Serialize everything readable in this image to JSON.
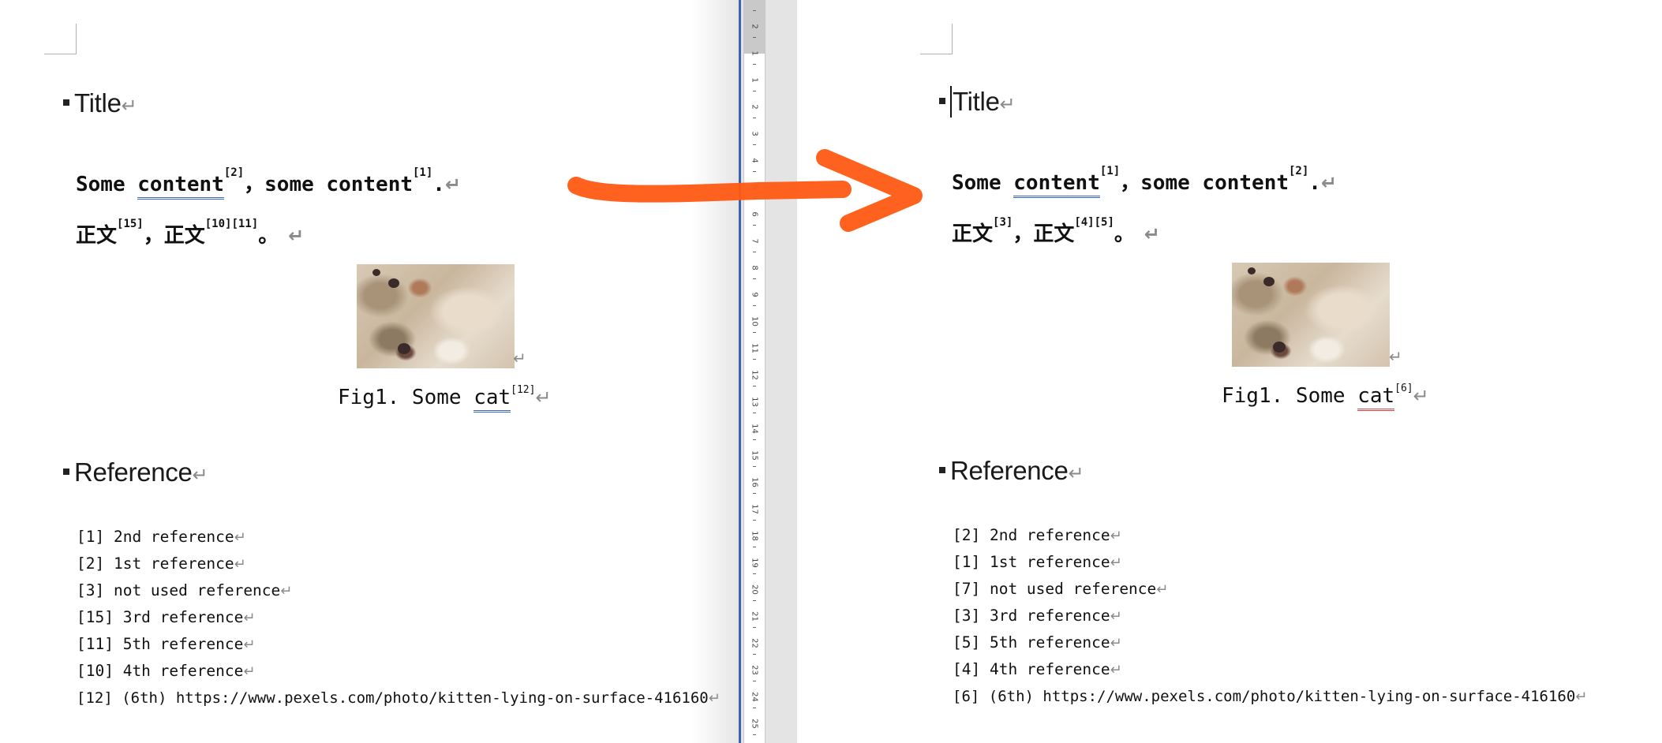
{
  "left": {
    "title": "Title",
    "line1": {
      "a": "Some ",
      "b": "content",
      "c": "[2]",
      "d": "，some content",
      "e": "[1]",
      "f": "."
    },
    "line2": {
      "a": "正文",
      "b": "[15]",
      "c": "，正文",
      "d": "[10][11]",
      "e": "。"
    },
    "caption": {
      "a": "Fig1. Some ",
      "b": "cat",
      "c": "[12]"
    },
    "reference_heading": "Reference",
    "refs": [
      "[1] 2nd reference",
      "[2] 1st reference",
      "[3] not used reference",
      "[15] 3rd reference",
      "[11] 5th reference",
      "[10] 4th reference",
      "[12] (6th) https://www.pexels.com/photo/kitten-lying-on-surface-416160"
    ]
  },
  "right": {
    "title": "Title",
    "line1": {
      "a": "Some ",
      "b": "content",
      "c": "[1]",
      "d": "，some content",
      "e": "[2]",
      "f": "."
    },
    "line2": {
      "a": "正文",
      "b": "[3]",
      "c": "，正文",
      "d": "[4][5]",
      "e": "。"
    },
    "caption": {
      "a": "Fig1. Some ",
      "b": "cat",
      "c": "[6]"
    },
    "reference_heading": "Reference",
    "refs": [
      "[2] 2nd reference",
      "[1] 1st reference",
      "[7] not used reference",
      "[3] 3rd reference",
      "[5] 5th reference",
      "[4] 4th reference",
      "[6] (6th) https://www.pexels.com/photo/kitten-lying-on-surface-416160"
    ]
  },
  "paragraph_mark": "↵",
  "ruler_numbers": [
    "2",
    "1",
    "1",
    "2",
    "3",
    "4",
    "5",
    "6",
    "7",
    "8",
    "9",
    "10",
    "11",
    "12",
    "13",
    "14",
    "15",
    "16",
    "17",
    "18",
    "19",
    "20",
    "21",
    "22",
    "23",
    "24",
    "25"
  ],
  "colors": {
    "arrow": "#ff5a12",
    "ruler_line": "#3d63b0",
    "underline_blue": "#3a66c4",
    "underline_red": "#d44848"
  },
  "image_alt": "kitten-lying-on-surface"
}
